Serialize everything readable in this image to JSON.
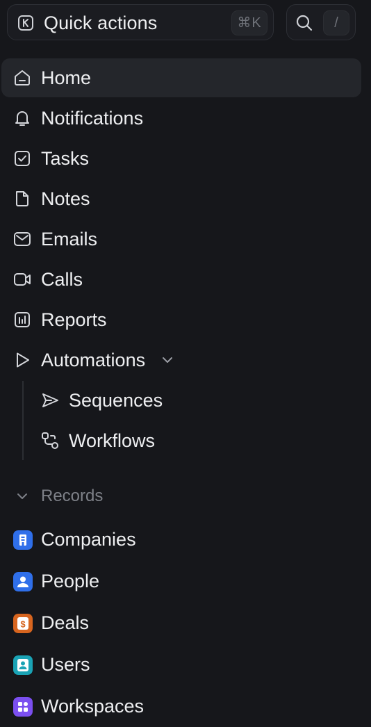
{
  "topbar": {
    "quick_actions_label": "Quick actions",
    "quick_actions_shortcut": "⌘K",
    "search_shortcut": "/"
  },
  "nav": {
    "items": [
      {
        "label": "Home",
        "icon": "home-icon",
        "active": true
      },
      {
        "label": "Notifications",
        "icon": "bell-icon"
      },
      {
        "label": "Tasks",
        "icon": "checkbox-icon"
      },
      {
        "label": "Notes",
        "icon": "note-icon"
      },
      {
        "label": "Emails",
        "icon": "mail-icon"
      },
      {
        "label": "Calls",
        "icon": "video-icon"
      },
      {
        "label": "Reports",
        "icon": "chart-icon"
      },
      {
        "label": "Automations",
        "icon": "play-icon",
        "expanded": true
      }
    ],
    "sub_items": [
      {
        "label": "Sequences",
        "icon": "send-icon"
      },
      {
        "label": "Workflows",
        "icon": "workflow-icon"
      }
    ]
  },
  "records": {
    "header": "Records",
    "items": [
      {
        "label": "Companies",
        "icon": "building-icon",
        "color": "#2f6fea"
      },
      {
        "label": "People",
        "icon": "person-icon",
        "color": "#2f6fea"
      },
      {
        "label": "Deals",
        "icon": "dollar-icon",
        "color": "#d7651f"
      },
      {
        "label": "Users",
        "icon": "user-icon",
        "color": "#1aa3b5"
      },
      {
        "label": "Workspaces",
        "icon": "grid-icon",
        "color": "#7b4ff0"
      }
    ]
  },
  "colors": {
    "background": "#16171b",
    "active_item": "#24262b",
    "text": "#eeeff1",
    "muted": "#7e8188"
  }
}
